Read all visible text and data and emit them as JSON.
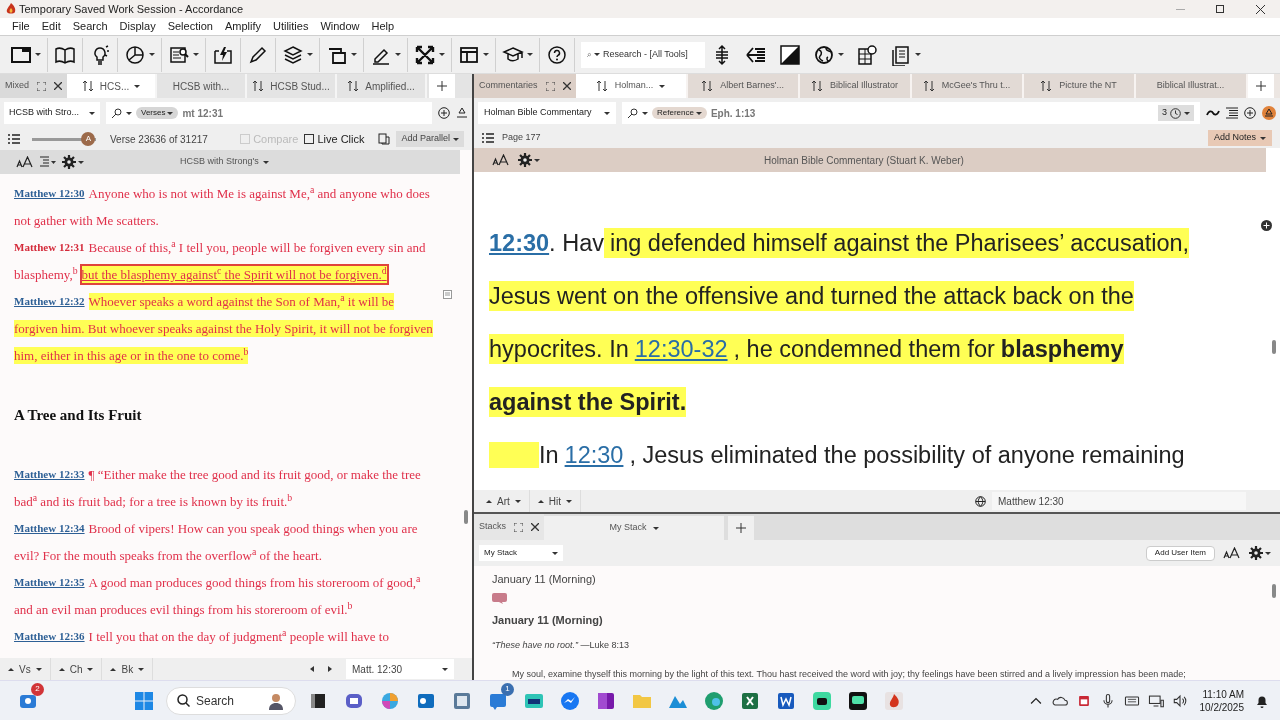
{
  "window": {
    "title": "Temporary Saved Work Session - Accordance"
  },
  "menu": [
    "File",
    "Edit",
    "Search",
    "Display",
    "Selection",
    "Amplify",
    "Utilities",
    "Window",
    "Help"
  ],
  "toolbar": {
    "search_placeholder": "Research - [All Tools]"
  },
  "left_pane": {
    "zone": "Mixed",
    "tabs": [
      {
        "label": "HCS...",
        "selected": true,
        "sort": true
      },
      {
        "label": "HCSB with...",
        "selected": false,
        "sort": false
      },
      {
        "label": "HCSB Stud...",
        "selected": false,
        "sort": true
      },
      {
        "label": "Amplified...",
        "selected": false,
        "sort": true
      }
    ],
    "module": "HCSB with Stro...",
    "search_mode": "Verses",
    "search_text": "mt 12:31",
    "slider": {
      "level": 0.88,
      "thumb": "A"
    },
    "verse_status": "Verse 23636 of 31217",
    "compare": {
      "label": "Compare",
      "checked": false,
      "disabled": true
    },
    "live_click": {
      "label": "Live Click",
      "checked": false,
      "disabled": false
    },
    "add_parallel": "Add Parallel",
    "title": "HCSB with Strong's",
    "content": [
      {
        "kind": "verse",
        "ref": "Matthew 12:30",
        "selected": false,
        "lines": [
          [
            {
              "text": "Anyone who is not with Me is against Me,$^{a}$ and anyone who does",
              "highlighted": false,
              "outlined": false
            }
          ],
          [
            {
              "text": "not gather with Me scatters.",
              "highlighted": false,
              "outlined": false
            }
          ]
        ]
      },
      {
        "kind": "verse",
        "ref": "Matthew 12:31",
        "selected": true,
        "lines": [
          [
            {
              "text": "Because of this,$^{a}$ I tell you, people will be forgiven every sin and",
              "highlighted": false,
              "outlined": false
            }
          ],
          [
            {
              "text": "blasphemy,$^{b}$",
              "highlighted": false,
              "outlined": false
            },
            {
              "text": "but the blasphemy against$^{c}$ the Spirit will not be forgiven.$^{d}$",
              "highlighted": true,
              "outlined": true
            }
          ]
        ]
      },
      {
        "kind": "verse",
        "ref": "Matthew 12:32",
        "selected": false,
        "lines": [
          [
            {
              "text": "Whoever speaks a word against the Son of Man,$^{a}$ it will be",
              "highlighted": true,
              "outlined": false
            }
          ],
          [
            {
              "text": "forgiven him. But whoever speaks against the Holy Spirit, it will not be forgiven",
              "highlighted": true,
              "outlined": false
            }
          ],
          [
            {
              "text": "him, either in this age or in the one to come.$^{b}$",
              "highlighted": true,
              "outlined": false
            }
          ]
        ]
      },
      {
        "kind": "heading",
        "text": "A Tree and Its Fruit"
      },
      {
        "kind": "verse",
        "ref": "Matthew 12:33",
        "selected": false,
        "lines": [
          [
            {
              "text": "¶ “Either make the tree good and its fruit good, or make the tree",
              "highlighted": false,
              "outlined": false
            }
          ],
          [
            {
              "text": "bad$^{a}$ and its fruit bad; for a tree is known by its fruit.$^{b}$",
              "highlighted": false,
              "outlined": false
            }
          ]
        ]
      },
      {
        "kind": "verse",
        "ref": "Matthew 12:34",
        "selected": false,
        "lines": [
          [
            {
              "text": "Brood of vipers! How can you speak good things when you are",
              "highlighted": false,
              "outlined": false
            }
          ],
          [
            {
              "text": "evil? For the mouth speaks from the overflow$^{a}$ of the heart.",
              "highlighted": false,
              "outlined": false
            }
          ]
        ]
      },
      {
        "kind": "verse",
        "ref": "Matthew 12:35",
        "selected": false,
        "lines": [
          [
            {
              "text": "A good man produces good things from his storeroom of good,$^{a}$",
              "highlighted": false,
              "outlined": false
            }
          ],
          [
            {
              "text": "and an evil man produces evil things from his storeroom of evil.$^{b}$",
              "highlighted": false,
              "outlined": false
            }
          ]
        ]
      },
      {
        "kind": "verse",
        "ref": "Matthew 12:36",
        "selected": false,
        "lines": [
          [
            {
              "text": "I tell you that on the day of judgment$^{a}$ people will have to",
              "highlighted": false,
              "outlined": false
            }
          ]
        ]
      }
    ],
    "footer": {
      "buttons": [
        "Vs",
        "Ch",
        "Bk"
      ],
      "location": "Matt. 12:30"
    }
  },
  "right_pane": {
    "zone": "Commentaries",
    "tabs": [
      {
        "label": "Holman...",
        "selected": true
      },
      {
        "label": "Albert Barnes'...",
        "selected": false
      },
      {
        "label": "Biblical Illustrator",
        "selected": false
      },
      {
        "label": "McGee's Thru t...",
        "selected": false
      },
      {
        "label": "Picture the NT",
        "selected": false
      },
      {
        "label": "Biblical Illustrat...",
        "selected": false
      }
    ],
    "module": "Holman Bible Commentary",
    "search_mode": "Reference",
    "search_text": "Eph. 1:13",
    "count": "3",
    "page": "Page 177",
    "add_notes": "Add Notes",
    "title": "Holman Bible Commentary (Stuart K. Weber)",
    "paragraphs": [
      {
        "leading_highlight": false,
        "lines": [
          [
            {
              "text": "12:30",
              "kind": "ref",
              "highlight": false
            },
            {
              "text": ". Hav",
              "kind": "text",
              "highlight": false
            },
            {
              "text": "ing defended himself against the Pharisees’ accusation,",
              "kind": "text",
              "highlight": true
            }
          ],
          [
            {
              "text": "Jesus went on the offensive and turned the attack back on the",
              "kind": "text",
              "highlight": true
            }
          ],
          [
            {
              "text": "hypocrites. In",
              "kind": "text",
              "highlight": true
            },
            {
              "text": "12:30-32",
              "kind": "link",
              "highlight": true
            },
            {
              "text": ", he condemned them for",
              "kind": "text",
              "highlight": true
            },
            {
              "text": "blasphemy",
              "kind": "bold",
              "highlight": true
            }
          ],
          [
            {
              "text": "against the Spirit.",
              "kind": "bold",
              "highlight": true
            }
          ]
        ]
      },
      {
        "leading_highlight": true,
        "lines": [
          [
            {
              "text": "In",
              "kind": "text",
              "highlight": false
            },
            {
              "text": "12:30",
              "kind": "link",
              "highlight": false
            },
            {
              "text": ", Jesus eliminated the possibility of anyone remaining",
              "kind": "text",
              "highlight": false
            }
          ]
        ]
      }
    ],
    "footer": {
      "buttons": [
        "Art",
        "Hit"
      ],
      "location": "Matthew 12:30"
    }
  },
  "stacks": {
    "zone": "Stacks",
    "tab": "My Stack",
    "dropdown": "My Stack",
    "add_user_item": "Add User Item",
    "entries": [
      {
        "kind": "title",
        "text": "January 11 (Morning)"
      },
      {
        "kind": "note"
      },
      {
        "kind": "heading",
        "text": "January 11 (Morning)"
      },
      {
        "kind": "quote",
        "text": "*“These have no root.”* —Luke 8:13"
      },
      {
        "kind": "body",
        "text": "My soul, examine thyself this morning by the light of this text. Thou hast received the word with joy; thy feelings have been stirred and a lively impression has been made;"
      }
    ]
  },
  "taskbar": {
    "search": "Search",
    "badges": [
      "2",
      "1"
    ],
    "time": "11:10 AM",
    "date": "10/2/2025"
  }
}
